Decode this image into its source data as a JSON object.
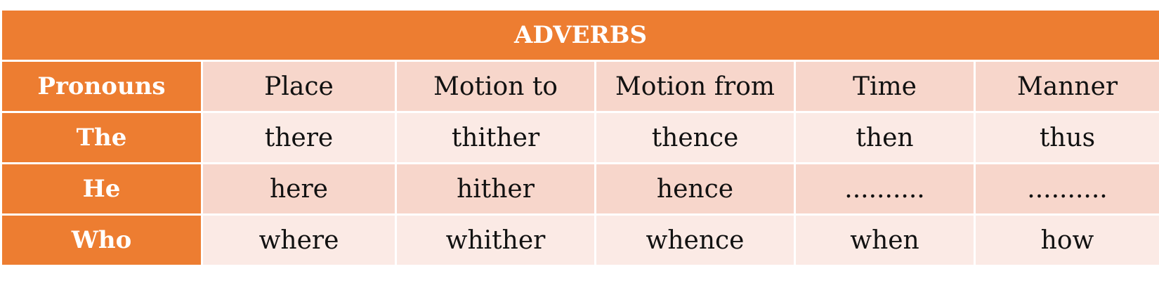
{
  "table": {
    "title": "ADVERBS",
    "header": {
      "row_label": "Pronouns",
      "columns": [
        "Place",
        "Motion to",
        "Motion from",
        "Time",
        "Manner"
      ]
    },
    "rows": [
      {
        "label": "The",
        "cells": [
          "there",
          "thither",
          "thence",
          "then",
          "thus"
        ]
      },
      {
        "label": "He",
        "cells": [
          "here",
          "hither",
          "hence",
          "..........",
          ".........."
        ]
      },
      {
        "label": "Who",
        "cells": [
          "where",
          "whither",
          "whence",
          "when",
          "how"
        ]
      }
    ]
  },
  "colors": {
    "accent": "#ed7d31",
    "band_dark": "#f7d6cb",
    "band_light": "#fbeae5",
    "header_text": "#ffffff",
    "body_text": "#111111"
  }
}
